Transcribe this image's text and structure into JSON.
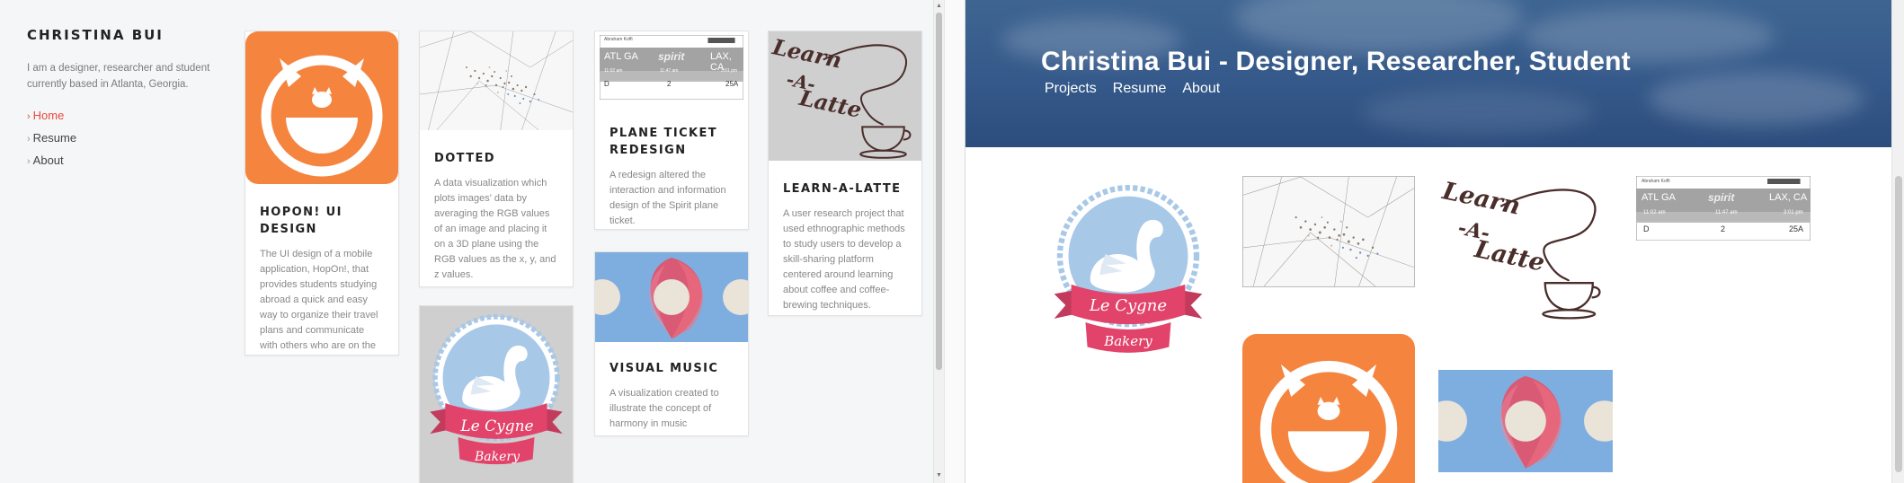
{
  "left": {
    "site_title": "CHRISTINA BUI",
    "intro": "I am a designer, researcher and student currently based in Atlanta, Georgia.",
    "nav": [
      {
        "label": "Home",
        "active": true
      },
      {
        "label": "Resume",
        "active": false
      },
      {
        "label": "About",
        "active": false
      }
    ],
    "cards": {
      "hopon": {
        "title": "HOPON! UI DESIGN",
        "desc": "The UI design of a mobile application, HopOn!, that provides students studying abroad a quick and easy way to organize their travel plans and communicate with others who are on the same trip."
      },
      "dotted": {
        "title": "DOTTED",
        "desc": "A data visualization which plots images' data by averaging the RGB values of an image and placing it on a 3D plane using the RGB values as the x, y, and z values."
      },
      "plane": {
        "title": "PLANE TICKET REDESIGN",
        "desc": "A redesign altered the interaction and information design of the Spirit plane ticket."
      },
      "music": {
        "title": "VISUAL MUSIC",
        "desc": "A visualization created to illustrate the concept of harmony in music"
      },
      "latte": {
        "title": "LEARN-A-LATTE",
        "desc": "A user research project that used ethnographic methods to study users to develop a skill-sharing platform centered around learning about coffee and coffee-brewing techniques."
      }
    }
  },
  "right": {
    "header_title": "Christina Bui - Designer, Researcher, Student",
    "nav": [
      "Projects",
      "Resume",
      "About"
    ]
  },
  "artwork": {
    "ticket": {
      "passenger": "Abraham Koffi",
      "brand": "spirit",
      "from": "ATL GA",
      "to": "LAX, CA",
      "dep": "11:02 am",
      "arr": "11:47 am",
      "arr2": "3:01 pm",
      "row1": "D",
      "row2": "2",
      "row3": "25A"
    },
    "latte": {
      "line1": "Learn",
      "line2": "-A-",
      "line3": "Latte"
    },
    "cygne": {
      "line1": "Le Cygne",
      "line2": "Bakery"
    }
  },
  "colors": {
    "accent": "#e8483b",
    "orange": "#f5843f",
    "hero_blue": "#35598a",
    "swan_blue": "#a8c8e8",
    "ribbon_pink": "#e1436a",
    "music_blue": "#7eaedf"
  }
}
